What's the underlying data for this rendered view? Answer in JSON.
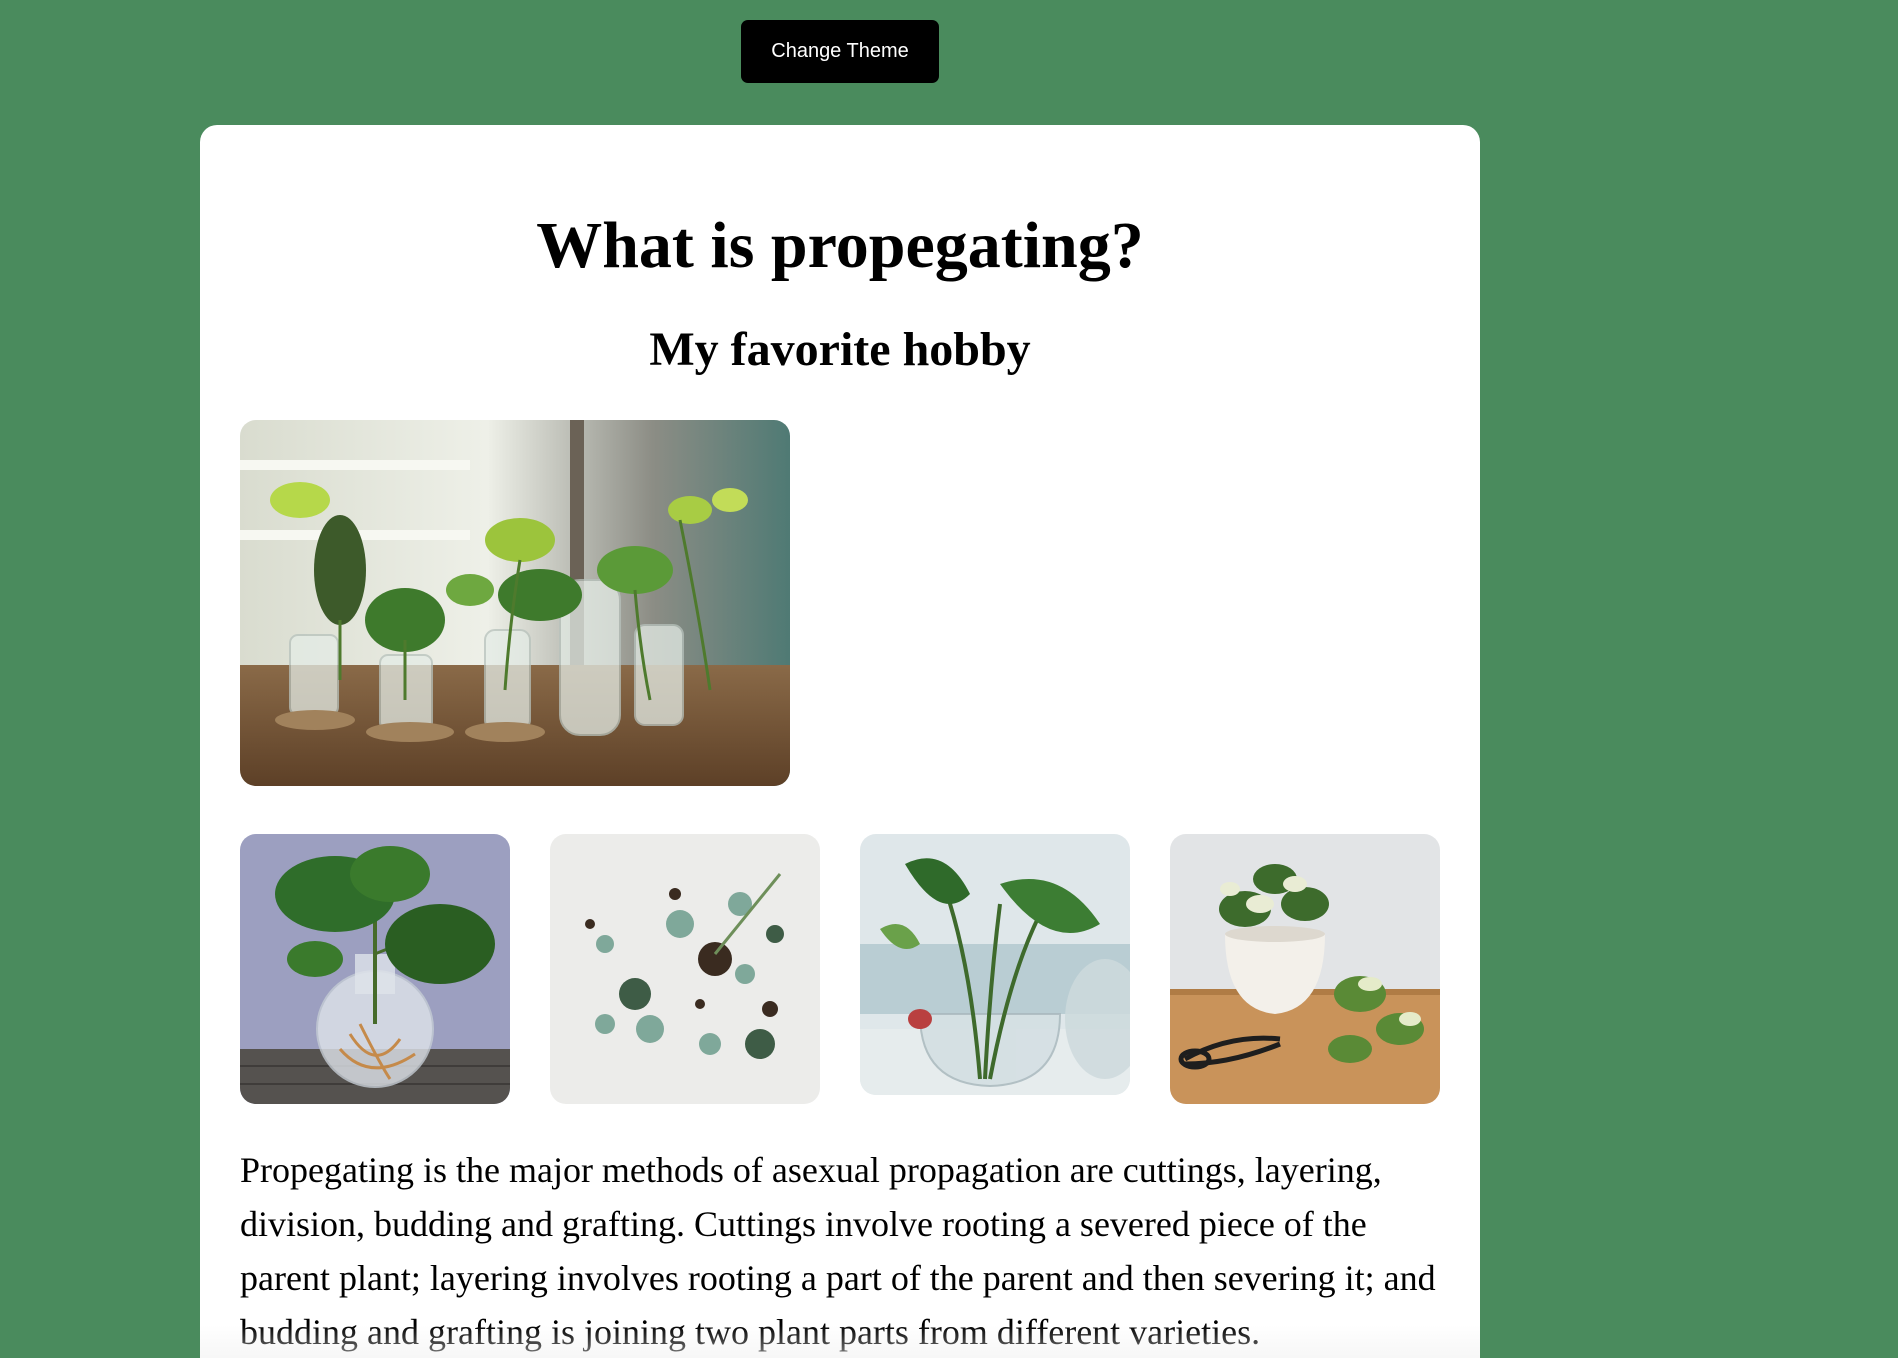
{
  "theme_button": {
    "label": "Change Theme"
  },
  "colors": {
    "page_background": "#4a8b5d",
    "card_background": "#ffffff",
    "button_background": "#000000",
    "button_text": "#ffffff"
  },
  "article": {
    "title": "What is propegating?",
    "subtitle": "My favorite hobby",
    "body": "Propegating is the major methods of asexual propagation are cuttings, layering, division, budding and grafting. Cuttings involve rooting a severed piece of the parent plant; layering involves rooting a part of the parent and then severing it; and budding and grafting is joining two plant parts from different varieties."
  }
}
